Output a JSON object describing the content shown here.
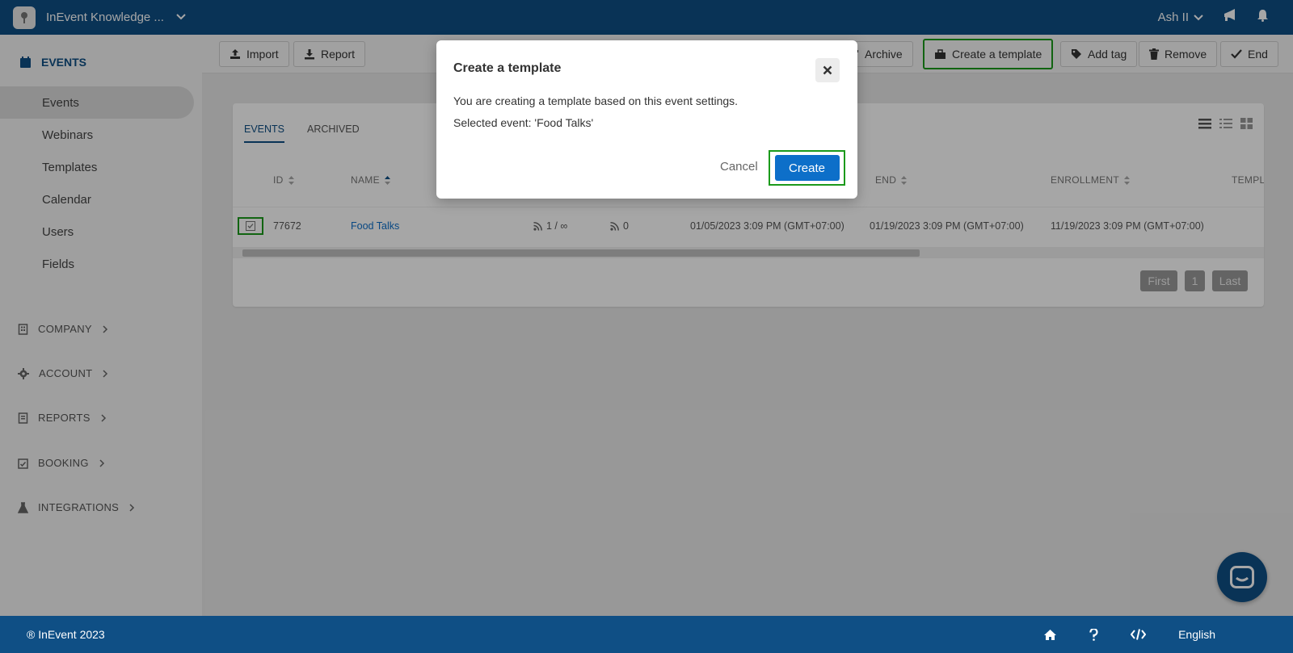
{
  "topbar": {
    "workspace_name": "InEvent Knowledge ...",
    "user_name": "Ash II"
  },
  "sidebar": {
    "section": "EVENTS",
    "items": [
      {
        "label": "Events",
        "active": true
      },
      {
        "label": "Webinars"
      },
      {
        "label": "Templates"
      },
      {
        "label": "Calendar"
      },
      {
        "label": "Users"
      },
      {
        "label": "Fields"
      }
    ],
    "groups": [
      {
        "label": "COMPANY",
        "icon": "building-icon"
      },
      {
        "label": "ACCOUNT",
        "icon": "gear-icon"
      },
      {
        "label": "REPORTS",
        "icon": "report-icon"
      },
      {
        "label": "BOOKING",
        "icon": "calendar-check-icon"
      },
      {
        "label": "INTEGRATIONS",
        "icon": "flask-icon"
      }
    ]
  },
  "toolbar": {
    "import": "Import",
    "report": "Report",
    "archive": "Archive",
    "create_template": "Create a template",
    "add_tag": "Add tag",
    "remove": "Remove",
    "end": "End"
  },
  "events_table": {
    "tabs": [
      "EVENTS",
      "ARCHIVED"
    ],
    "columns": {
      "id": "ID",
      "name": "NAME",
      "end": "END",
      "enrollment": "ENROLLMENT",
      "template": "TEMPL"
    },
    "row": {
      "id": "77672",
      "name": "Food Talks",
      "feed1": "1 / ∞",
      "feed2": "0",
      "start": "01/05/2023 3:09 PM (GMT+07:00)",
      "end": "01/19/2023 3:09 PM (GMT+07:00)",
      "enrollment": "11/19/2023 3:09 PM (GMT+07:00)"
    },
    "pagination": {
      "first": "First",
      "page": "1",
      "last": "Last"
    }
  },
  "modal": {
    "title": "Create a template",
    "text1": "You are creating a template based on this event settings.",
    "text2": "Selected event: 'Food Talks'",
    "cancel": "Cancel",
    "create": "Create"
  },
  "footer": {
    "copyright": "® InEvent 2023",
    "language": "English"
  },
  "colors": {
    "primary": "#0f4f85",
    "button_blue": "#0d6fc9",
    "highlight": "#1b9a1b"
  }
}
